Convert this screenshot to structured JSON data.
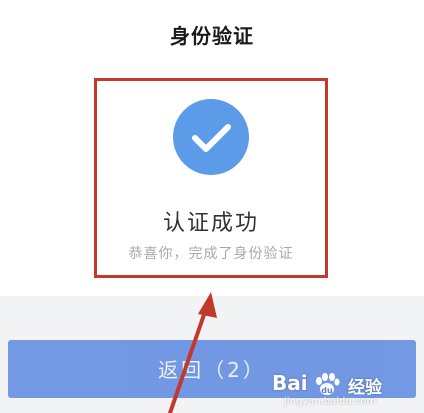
{
  "header": {
    "title": "身份验证"
  },
  "result": {
    "icon": "check-icon",
    "title": "认证成功",
    "subtitle": "恭喜你，完成了身份验证"
  },
  "footer": {
    "back_button_label": "返回（2）"
  },
  "watermark": {
    "logo": "Bai",
    "brand": "经验",
    "url": "jingyan.baidu.com"
  },
  "colors": {
    "accent_blue": "#4f7fe0",
    "check_circle": "#5b9be8",
    "highlight_border": "#c0392b"
  }
}
